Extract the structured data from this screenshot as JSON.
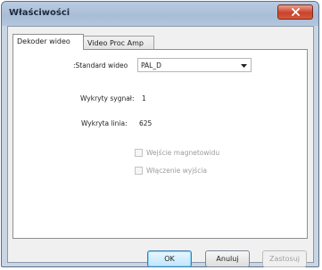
{
  "window": {
    "title": "Właściwości"
  },
  "tabs": [
    {
      "label": "Dekoder wideo",
      "active": true
    },
    {
      "label": "Video Proc Amp",
      "active": false
    }
  ],
  "decoder": {
    "standard_label": ":Standard wideo",
    "standard_value": "PAL_D",
    "signal_label": "Wykryty sygnał:",
    "signal_value": "1",
    "lines_label": "Wykryta linia:",
    "lines_value": "625",
    "checkbox_input": "Wejście magnetowidu",
    "checkbox_output": "Włączenie wyjścia"
  },
  "buttons": {
    "ok": "OK",
    "cancel": "Anuluj",
    "apply": "Zastosuj"
  },
  "icons": {
    "close": "close-icon",
    "dropdown": "chevron-down-icon"
  },
  "colors": {
    "titlebar": "#b8cbe2",
    "close_button": "#c9432b",
    "ok_button": "#bee6fd"
  }
}
